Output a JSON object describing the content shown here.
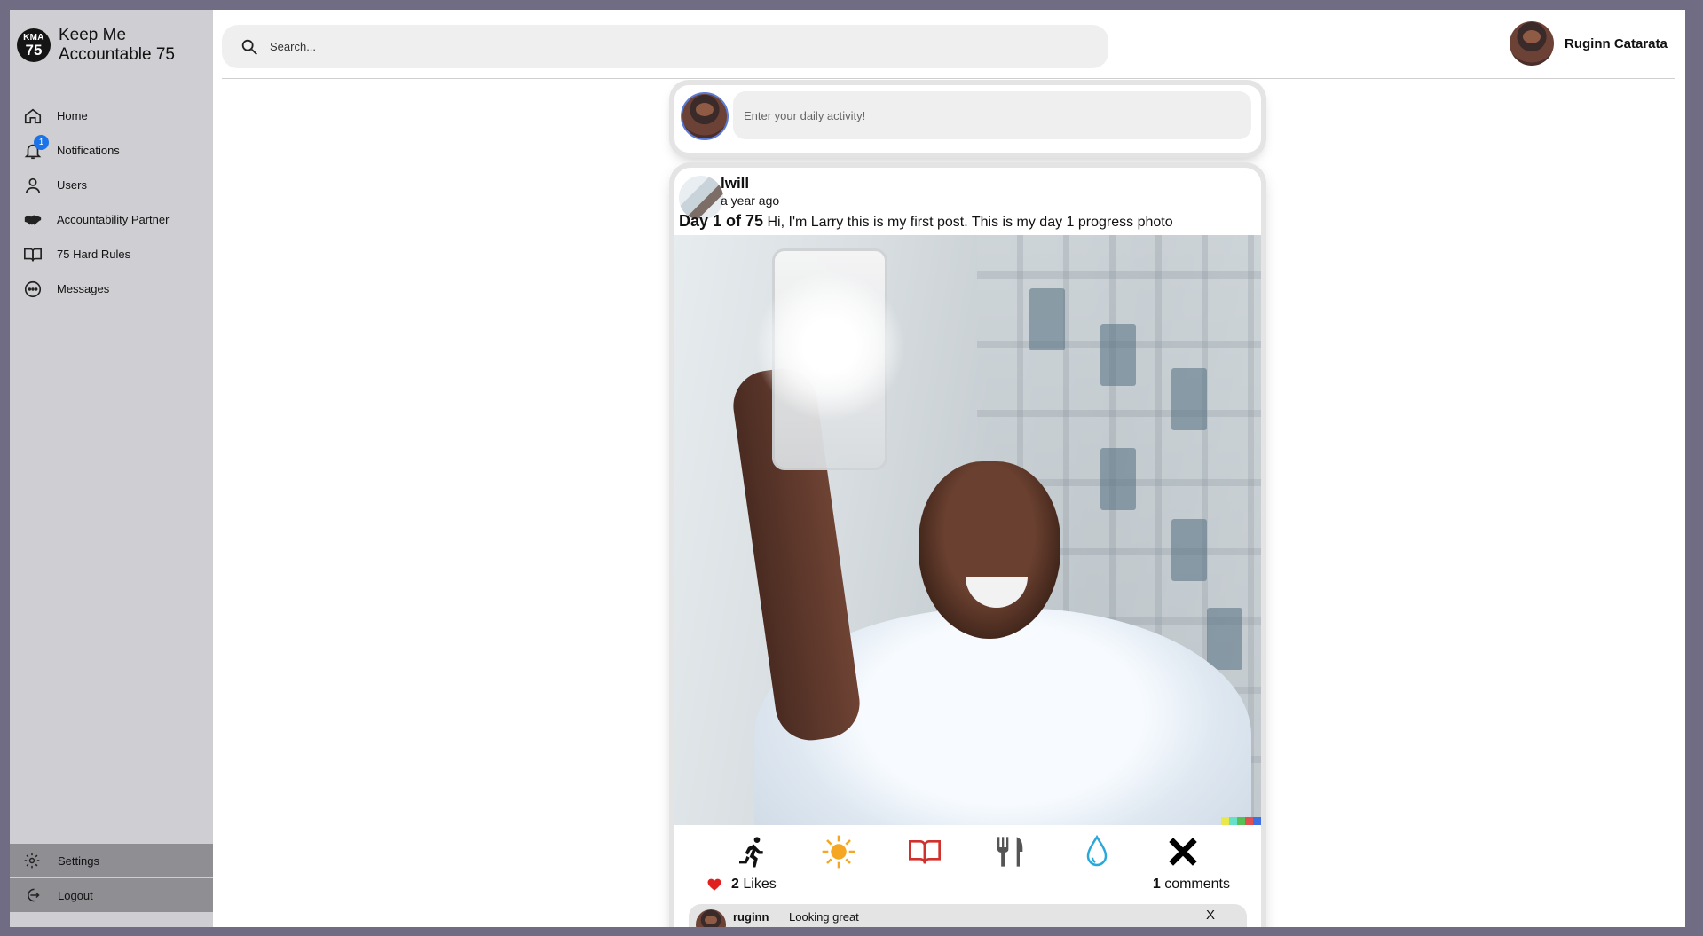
{
  "brand": {
    "logo_top": "KMA",
    "logo_bottom": "75",
    "name": "Keep Me Accountable 75"
  },
  "sidebar": {
    "items": [
      {
        "label": "Home",
        "icon": "home-icon"
      },
      {
        "label": "Notifications",
        "icon": "bell-icon",
        "badge": "1"
      },
      {
        "label": "Users",
        "icon": "user-icon"
      },
      {
        "label": "Accountability Partner",
        "icon": "handshake-icon"
      },
      {
        "label": "75 Hard Rules",
        "icon": "book-icon"
      },
      {
        "label": "Messages",
        "icon": "chat-bubble-icon"
      }
    ],
    "settings": "Settings",
    "logout": "Logout"
  },
  "header": {
    "search_placeholder": "Search...",
    "profile_name": "Ruginn Catarata"
  },
  "composer": {
    "placeholder": "Enter your daily activity!"
  },
  "post": {
    "username": "lwill",
    "time": "a year ago",
    "day": "Day 1 of 75",
    "text": "Hi, I'm Larry this is my first post. This is my day 1 progress photo",
    "habits": [
      {
        "icon": "running-icon",
        "color": "#111111"
      },
      {
        "icon": "sun-icon",
        "color": "#f5a623"
      },
      {
        "icon": "open-book-icon",
        "color": "#d0312d"
      },
      {
        "icon": "fork-knife-icon",
        "color": "#555555"
      },
      {
        "icon": "water-drop-icon",
        "color": "#2aa8d8"
      },
      {
        "icon": "x-mark-icon",
        "color": "#000000"
      }
    ],
    "likes_count": "2",
    "likes_label": "Likes",
    "comments_count": "1",
    "comments_label": "comments",
    "comment": {
      "user": "ruginn",
      "text": "Looking great",
      "close": "X"
    }
  },
  "colors": {
    "sidebar_bg": "#cfcfd3",
    "sidebar_bottom_bg": "#8e8e93",
    "badge": "#1a73e8",
    "like": "#e0201f"
  }
}
